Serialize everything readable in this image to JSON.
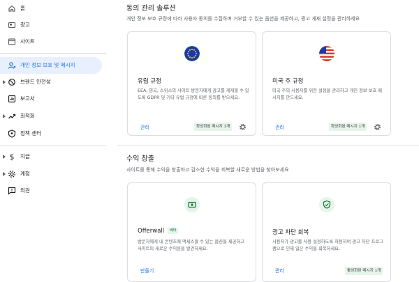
{
  "sidebar": {
    "items": [
      {
        "label": "홈",
        "icon": "home-icon"
      },
      {
        "label": "광고",
        "icon": "ads-icon"
      },
      {
        "label": "사이트",
        "icon": "sites-icon"
      },
      {
        "label": "개인 정보 보호 및 메시지",
        "icon": "privacy-messaging-icon"
      },
      {
        "label": "브랜드 안전성",
        "icon": "brand-safety-icon"
      },
      {
        "label": "보고서",
        "icon": "reports-icon"
      },
      {
        "label": "최적화",
        "icon": "optimization-icon"
      },
      {
        "label": "정책 센터",
        "icon": "policy-center-icon"
      },
      {
        "label": "지급",
        "icon": "payments-icon"
      },
      {
        "label": "계정",
        "icon": "account-icon"
      },
      {
        "label": "의견",
        "icon": "feedback-icon"
      }
    ]
  },
  "consent": {
    "title": "동의 관리 솔루션",
    "desc": "개인 정보 보호 규정에 따라 사용자 동의를 수집하며 거부할 수 있는 옵션을 제공하고, 광고 게재 설정을 관리하세요",
    "cards": [
      {
        "icon": "eu-flag-icon",
        "title": "유럽 규정",
        "desc": "EEA, 영국, 스위스의 사이트 방문자에게 광고를 게재할 수 있도록 GDPR 및 기타 유럽 규정에 따른 동의를 받으세요.",
        "link": "관리",
        "badge": "확성화된 메시지 1개"
      },
      {
        "icon": "us-flag-icon",
        "title": "미국 주 규정",
        "desc": "미국 주의 사용자를 위한 설정을 관리하고 개인 정보 보호 메시지를 만드세요.",
        "link": "관리",
        "badge": "확성화된 메시지 1개"
      }
    ]
  },
  "revenue": {
    "title": "수익 창출",
    "desc": "사이트를 통해 수익을 창출하고 감소한 수익을 회복할 새로운 방법을 찾아보세요",
    "cards": [
      {
        "icon": "offerwall-icon",
        "title": "Offerwall",
        "beta": "베타",
        "desc": "방문자에게 내 콘텐츠에 액세스할 수 있는 옵션을 제공하고 사이트의 새로운 수익원을 발견하세요.",
        "link": "만들기"
      },
      {
        "icon": "ad-blocking-recovery-icon",
        "title": "광고 차단 회복",
        "desc": "사용자가 광고를 사용 설정하도록 허용하여 광고 차단 프로그램으로 인해 잃은 수익을 회복하세요.",
        "link": "관리",
        "badge": "활성화된 메시지 1개"
      }
    ]
  },
  "colors": {
    "accent": "#1a73e8",
    "active_bg": "#e8f0fe",
    "badge_bg": "#e6f4ea"
  }
}
